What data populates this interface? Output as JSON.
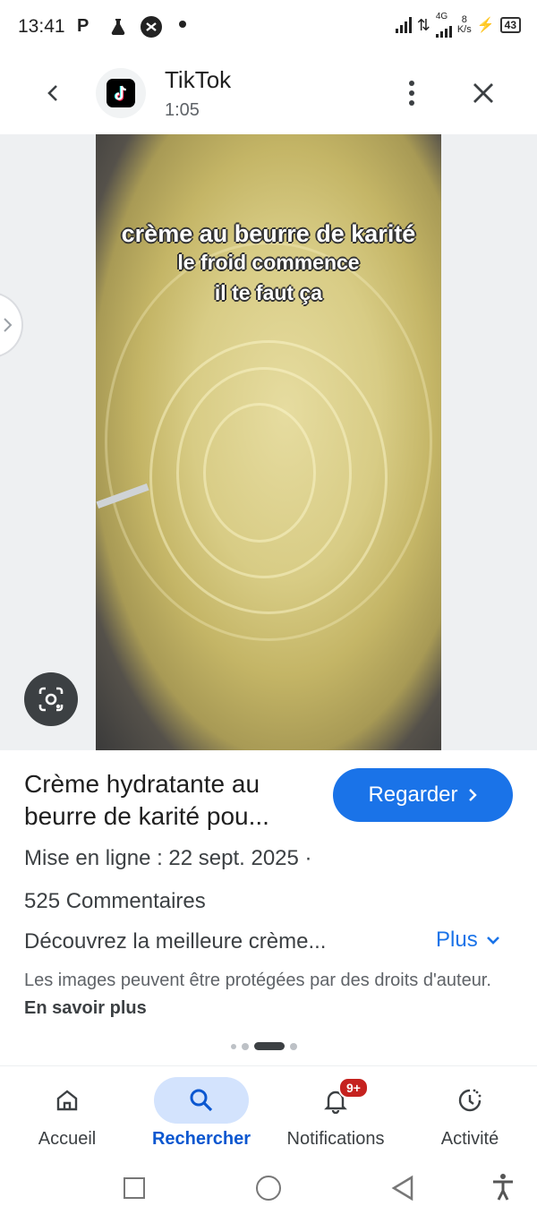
{
  "status_bar": {
    "time": "13:41",
    "network_type": "4G",
    "speed_value": "8",
    "speed_unit": "K/s",
    "battery": "43"
  },
  "header": {
    "source_title": "TikTok",
    "duration": "1:05"
  },
  "media": {
    "overlay_line1": "crème au beurre de karité",
    "overlay_line2": "le froid commence",
    "overlay_line3": "il te faut ça"
  },
  "result": {
    "title": "Crème hydratante au beurre de karité pou...",
    "watch_label": "Regarder",
    "upload_date": "Mise en ligne : 22 sept. 2025 ·",
    "comments": "525 Commentaires",
    "description": "Découvrez la meilleure crème...",
    "more_label": "Plus",
    "copyright_text": "Les images peuvent être protégées par des droits d'auteur.",
    "learn_more": "En savoir plus"
  },
  "bottom_nav": {
    "items": [
      {
        "label": "Accueil",
        "icon": "home-icon"
      },
      {
        "label": "Rechercher",
        "icon": "search-icon",
        "active": true
      },
      {
        "label": "Notifications",
        "icon": "bell-icon",
        "badge": "9+"
      },
      {
        "label": "Activité",
        "icon": "activity-icon"
      }
    ]
  },
  "colors": {
    "accent": "#1a73e8",
    "active_nav_bg": "#d3e3fd",
    "badge": "#c5221f"
  }
}
